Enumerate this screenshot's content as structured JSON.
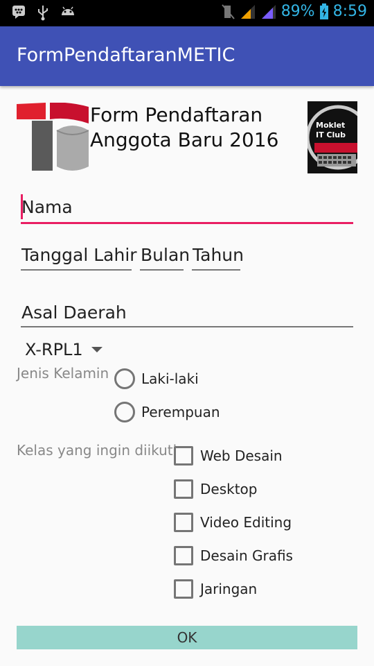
{
  "status_bar": {
    "battery_percent": "89%",
    "time": "8:59",
    "icons": [
      "bbm-icon",
      "usb-icon",
      "android-icon",
      "mute-icon",
      "signal-icon",
      "signal-icon-2",
      "battery-icon"
    ]
  },
  "app_bar": {
    "title": "FormPendaftaranMETIC"
  },
  "header": {
    "title_line1": "Form Pendaftaran",
    "title_line2": "Anggota Baru 2016",
    "badge_line1": "Moklet",
    "badge_line2": "IT Club"
  },
  "form": {
    "nama_placeholder": "Nama",
    "tanggal_lahir_placeholder": "Tanggal Lahir",
    "bulan_placeholder": "Bulan",
    "tahun_placeholder": "Tahun",
    "asal_daerah_placeholder": "Asal Daerah",
    "kelas_select_value": "X-RPL1",
    "gender_label": "Jenis Kelamin",
    "gender_options": [
      "Laki-laki",
      "Perempuan"
    ],
    "kelas_label": "Kelas yang ingin diikuti",
    "class_options": [
      "Web Desain",
      "Desktop",
      "Video Editing",
      "Desain Grafis",
      "Jaringan"
    ],
    "ok_label": "OK"
  },
  "colors": {
    "app_bar": "#3f51b5",
    "accent": "#e91e63",
    "ok_button": "#97d5cc",
    "status_icons": "#33b5e5"
  }
}
